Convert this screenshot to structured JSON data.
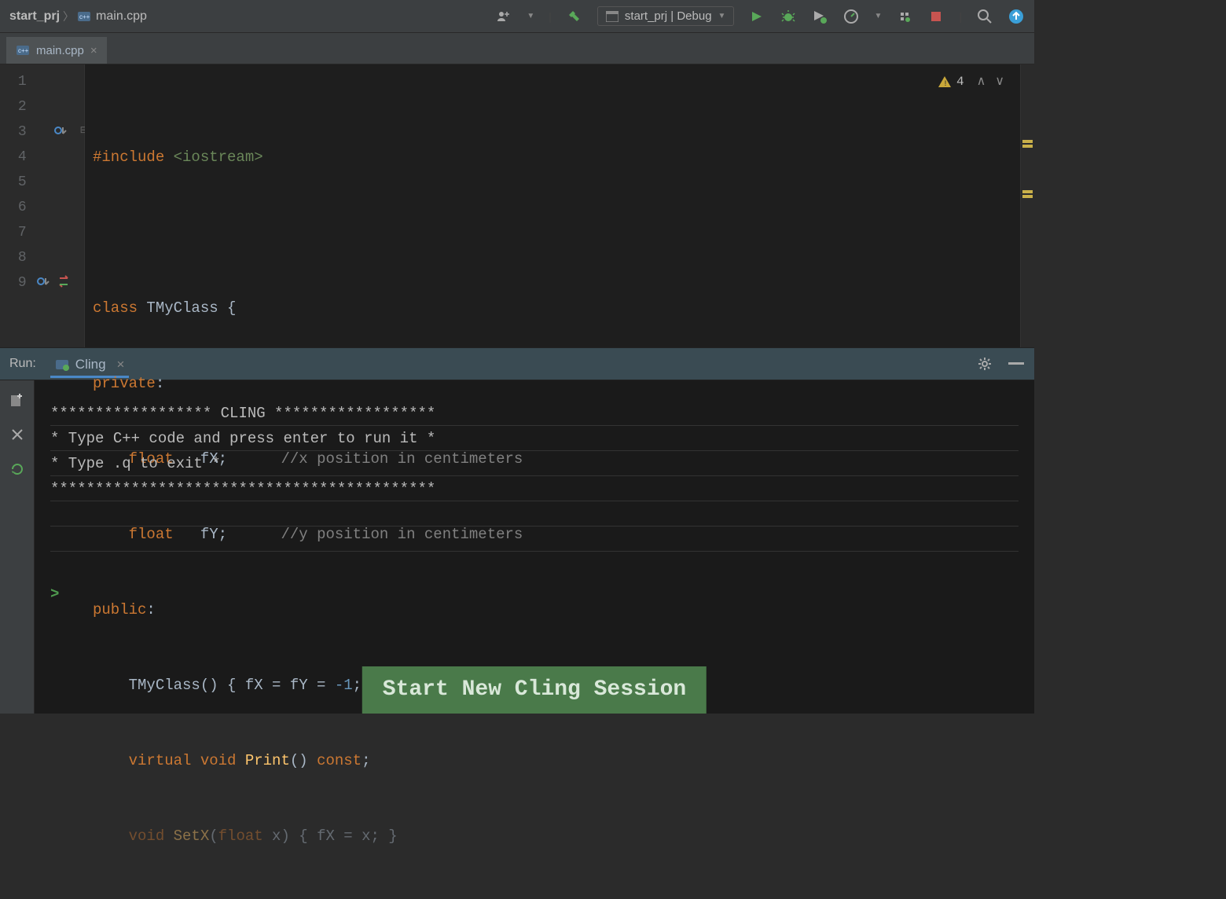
{
  "breadcrumb": {
    "project": "start_prj",
    "file": "main.cpp"
  },
  "run_config": {
    "label": "start_prj | Debug"
  },
  "tabs": [
    {
      "label": "main.cpp"
    }
  ],
  "warnings": {
    "count": "4"
  },
  "gutter_lines": [
    "1",
    "2",
    "3",
    "4",
    "5",
    "6",
    "7",
    "8",
    "9"
  ],
  "code": {
    "l1_include": "#include",
    "l1_header": " <iostream>",
    "l3_class": "class",
    "l3_name": " TMyClass {",
    "l4_private": "private",
    "l4_colon": ":",
    "l5_float": "float",
    "l5_var": "   fX;",
    "l5_comment": "      //x position in centimeters",
    "l6_float": "float",
    "l6_var": "   fY;",
    "l6_comment": "      //y position in centimeters",
    "l7_public": "public",
    "l7_colon": ":",
    "l8_ctor": "TMyClass() { fX = fY = ",
    "l8_num": "-1",
    "l8_end": "; }",
    "l9_virtual": "virtual void ",
    "l9_fn": "Print",
    "l9_rest": "() ",
    "l9_const": "const",
    "l9_semi": ";",
    "l10_partial_a": "void ",
    "l10_partial_b": "SetX",
    "l10_partial_c": "(",
    "l10_partial_d": "float",
    "l10_partial_e": " x) { fX = x; }"
  },
  "panel": {
    "run_label": "Run:",
    "tab": "Cling"
  },
  "console": {
    "line1": "****************** CLING ******************",
    "line2": "* Type C++ code and press enter to run it *",
    "line3": "*             Type .q to exit             *",
    "line4": "*******************************************",
    "prompt": ">"
  },
  "banner": "Start New Cling Session"
}
